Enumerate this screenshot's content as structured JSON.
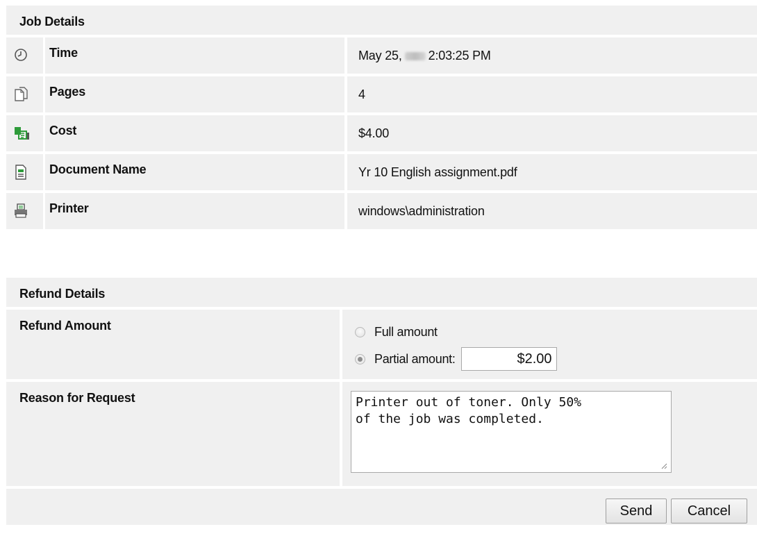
{
  "job": {
    "header": "Job Details",
    "rows": [
      {
        "icon": "clock-icon",
        "label": "Time",
        "value_prefix": "May 25,",
        "value_suffix": "2:03:25 PM"
      },
      {
        "icon": "pages-icon",
        "label": "Pages",
        "value": "4"
      },
      {
        "icon": "cost-icon",
        "label": "Cost",
        "value": "$4.00"
      },
      {
        "icon": "document-icon",
        "label": "Document Name",
        "value": "Yr 10 English assignment.pdf"
      },
      {
        "icon": "printer-icon",
        "label": "Printer",
        "value": "windows\\administration"
      }
    ]
  },
  "refund": {
    "header": "Refund Details",
    "amount_label": "Refund Amount",
    "full_option": "Full amount",
    "partial_option": "Partial amount:",
    "selected_option": "partial",
    "partial_value": "$2.00",
    "reason_label": "Reason for Request",
    "reason_text": "Printer out of toner. Only 50%\nof the job was completed."
  },
  "actions": {
    "send_label": "Send",
    "cancel_label": "Cancel"
  },
  "colors": {
    "panel_bg": "#f0f0f0",
    "cost_icon_green": "#2e9b3a"
  }
}
